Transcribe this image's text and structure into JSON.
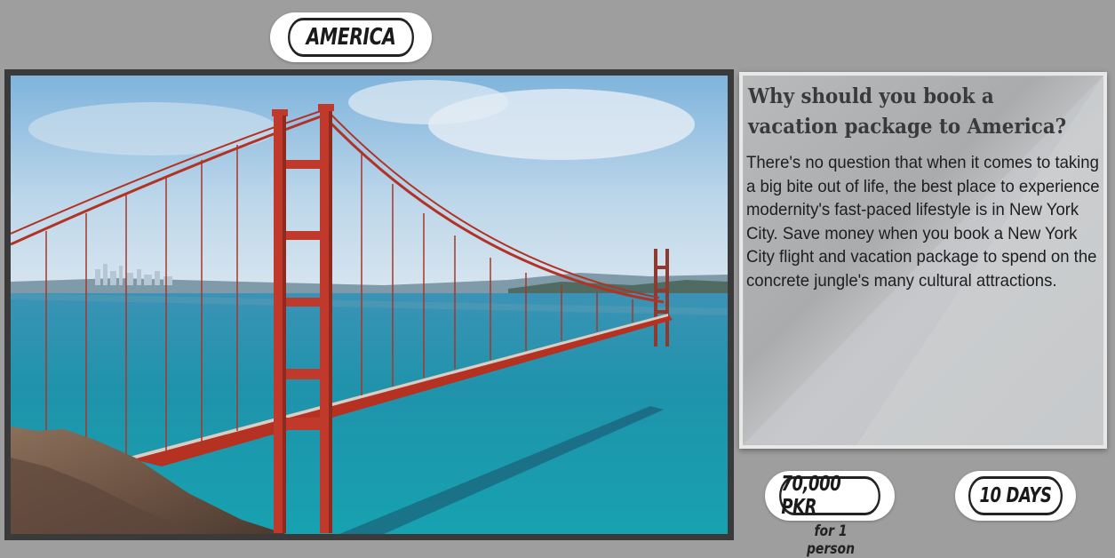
{
  "destination": {
    "title": "AMERICA"
  },
  "info": {
    "heading": "Why should you book a vacation package to America?",
    "body": "There's no question that when it comes to taking a big bite out of life, the best place to experience modernity's fast-paced lifestyle is in New York City. Save money when you book a New York City flight and vacation package to spend on the concrete jungle's many cultural attractions."
  },
  "price": {
    "amount": "70,000 PKR",
    "note": "for 1 person"
  },
  "duration": {
    "label": "10 DAYS"
  },
  "colors": {
    "background": "#9e9e9e",
    "bridge": "#c0392b",
    "water": "#1f8fae"
  }
}
